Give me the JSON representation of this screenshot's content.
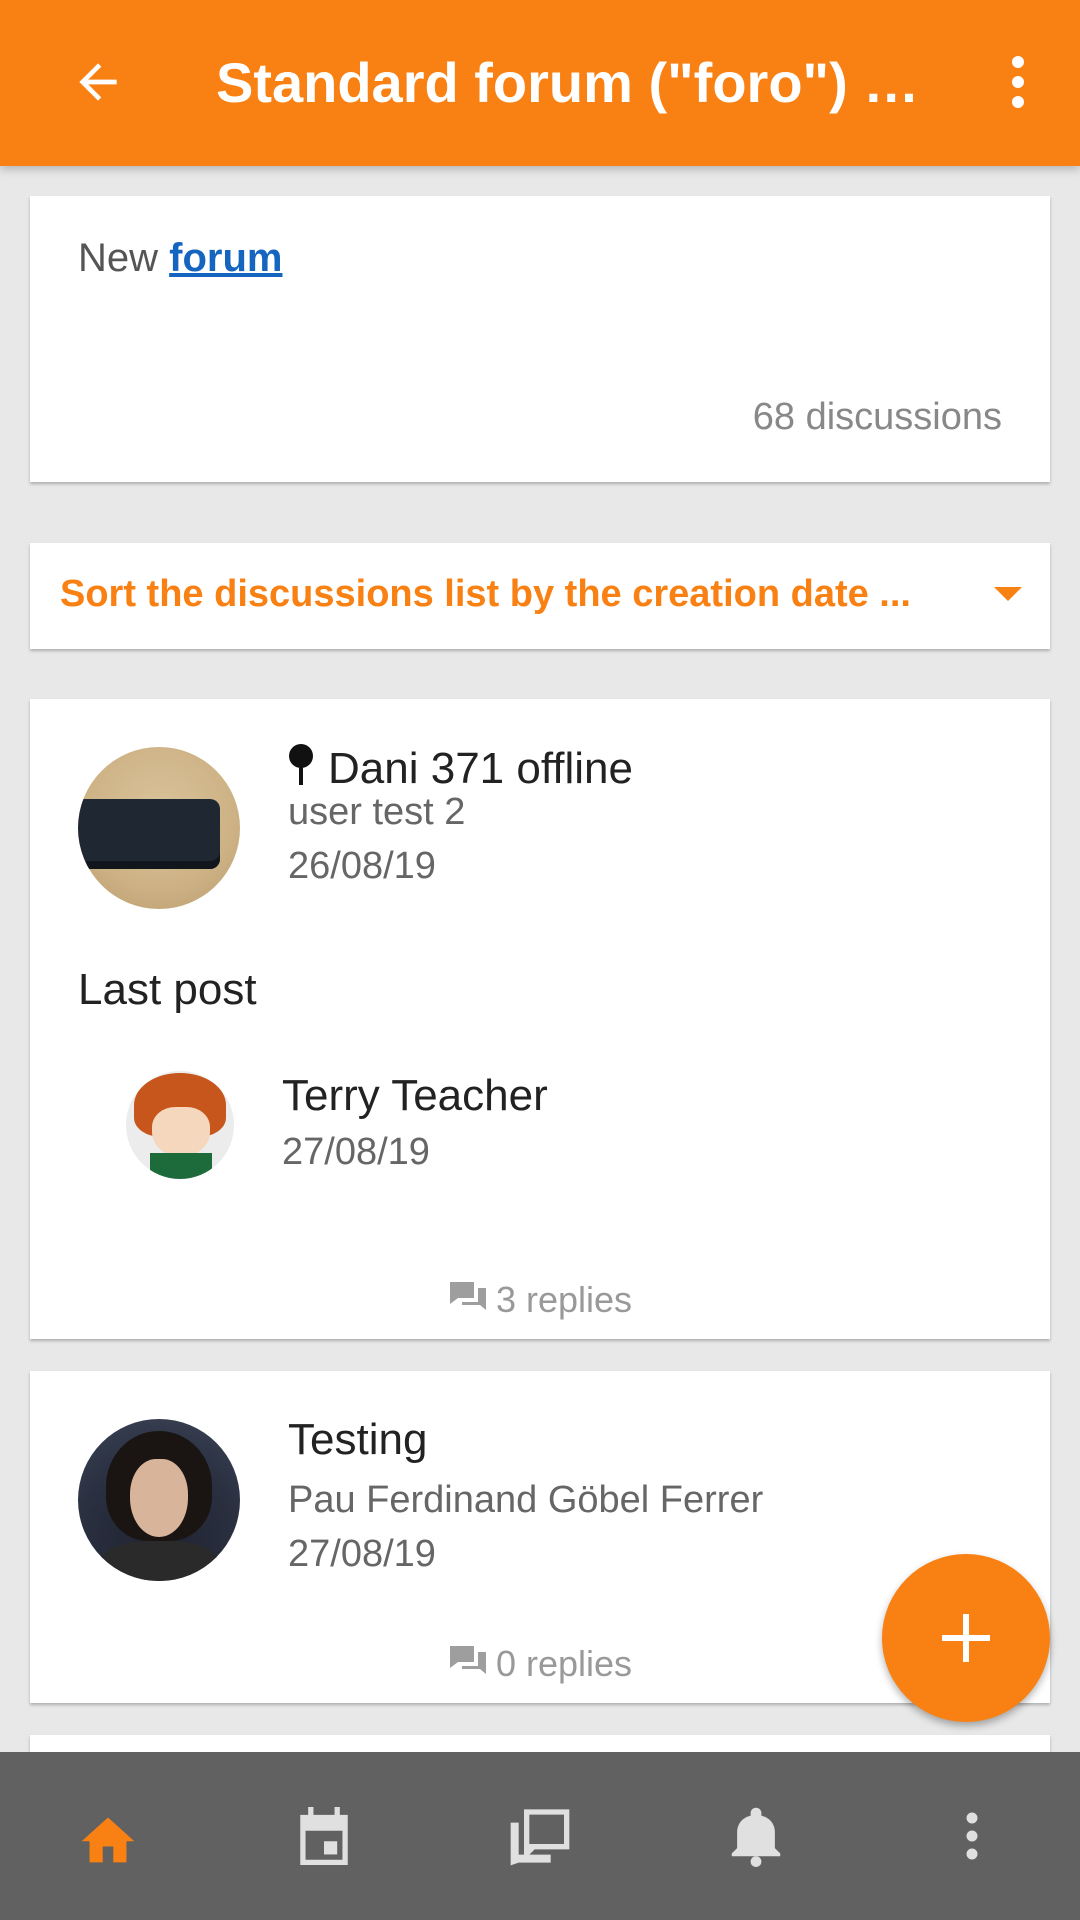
{
  "header": {
    "title": "Standard forum (\"foro\") (...",
    "back_icon": "arrow-back-icon",
    "menu_icon": "more-vertical-icon",
    "background": "#f98012"
  },
  "intro": {
    "prefix": "New ",
    "link_text": "forum",
    "discussions_count": "68 discussions"
  },
  "sort": {
    "label": "Sort the discussions list by the creation date ...",
    "icon": "caret-down-icon"
  },
  "discussions": [
    {
      "title": "Dani 371 offline",
      "pinned": true,
      "author": "user test 2",
      "date": "26/08/19",
      "last_post_label": "Last post",
      "last_post": {
        "name": "Terry Teacher",
        "date": "27/08/19"
      },
      "replies": "3 replies"
    },
    {
      "title": "Testing",
      "pinned": false,
      "author": "Pau Ferdinand Göbel Ferrer",
      "date": "27/08/19",
      "replies": "0 replies"
    }
  ],
  "fab": {
    "icon": "plus-icon"
  },
  "bottom_nav": [
    {
      "name": "home",
      "icon": "home-icon",
      "active": true
    },
    {
      "name": "calendar",
      "icon": "calendar-icon",
      "active": false
    },
    {
      "name": "messages",
      "icon": "messages-icon",
      "active": false
    },
    {
      "name": "notifications",
      "icon": "bell-icon",
      "active": false
    },
    {
      "name": "more",
      "icon": "more-vertical-icon",
      "active": false
    }
  ],
  "colors": {
    "accent": "#f98012",
    "link": "#1565c0",
    "nav_bg": "#616161",
    "nav_icon": "#e0e0e0"
  }
}
